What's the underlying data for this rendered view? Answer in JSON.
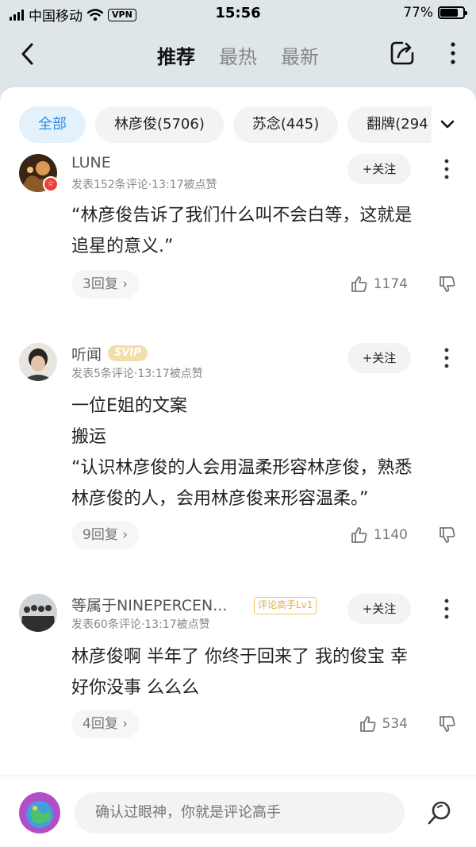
{
  "status_bar": {
    "carrier": "中国移动",
    "vpn": "VPN",
    "time": "15:56",
    "battery_pct": "77%",
    "battery_level": 0.77
  },
  "nav": {
    "tabs": [
      {
        "label": "推荐",
        "active": true
      },
      {
        "label": "最热",
        "active": false
      },
      {
        "label": "最新",
        "active": false
      }
    ]
  },
  "filters": {
    "chips": [
      {
        "label": "全部",
        "active": true
      },
      {
        "label": "林彦俊(5706)",
        "active": false
      },
      {
        "label": "苏念(445)",
        "active": false
      },
      {
        "label": "翻牌(294",
        "active": false
      }
    ]
  },
  "comments": [
    {
      "username": "LUNE",
      "meta": "发表152条评论·13:17被点赞",
      "badge": "",
      "follow_label": "+关注",
      "body": [
        "“林彦俊告诉了我们什么叫不会白等，这就是",
        "追星的意义.”"
      ],
      "replies": "3回复 ›",
      "likes": "1174"
    },
    {
      "username": "听闻",
      "meta": "发表5条评论·13:17被点赞",
      "badge": "SVIP",
      "follow_label": "+关注",
      "body": [
        "一位E姐的文案",
        "搬运",
        "“认识林彦俊的人会用温柔形容林彦俊，熟悉",
        "林彦俊的人，会用林彦俊来形容温柔。”"
      ],
      "replies": "9回复 ›",
      "likes": "1140"
    },
    {
      "username": "等属于NINEPERCEN...",
      "meta": "发表60条评论·13:17被点赞",
      "badge": "评论高手Lv1",
      "follow_label": "+关注",
      "body": [
        "林彦俊啊 半年了 你终于回来了 我的俊宝 幸",
        "好你没事 么么么"
      ],
      "replies": "4回复 ›",
      "likes": "534"
    }
  ],
  "bottom_bar": {
    "input_placeholder": "确认过眼神，你就是评论高手"
  },
  "colors": {
    "accent": "#2e8ee0",
    "chip_active_bg": "#e3f1fd",
    "svip_gold": "#f1dea9",
    "lv_badge": "#e9a93a"
  },
  "icons": [
    "back-icon",
    "share-icon",
    "more-icon",
    "chevron-down-icon",
    "thumb-up-icon",
    "thumb-down-icon",
    "search-icon"
  ]
}
